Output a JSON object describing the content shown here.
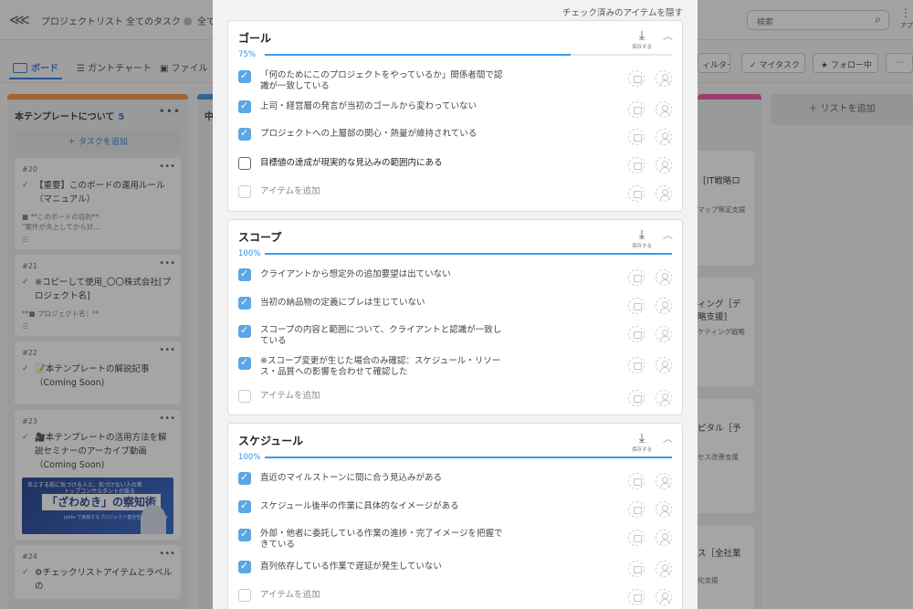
{
  "header": {
    "project_list": "プロジェクトリスト",
    "all_tasks": "全てのタスク",
    "all_prefix": "全て",
    "search_placeholder": "検索",
    "apps_label": "アプ"
  },
  "toolbar": {
    "tab_board": "ボード",
    "tab_gantt": "ガントチャート",
    "tab_file": "ファイル",
    "filter": "ィルター",
    "my_task": "マイタスク",
    "following": "フォロー中"
  },
  "board": {
    "column1": {
      "title": "本テンプレートについて",
      "count": "5",
      "add_task": "タスクを追加",
      "stripe_color": "#f5913e",
      "cards": [
        {
          "num": "#20",
          "title": "【重要】このボードの運用ルール（マニュアル）",
          "desc": "■ **このボードの目的**\n\"案件が炎上してから対..."
        },
        {
          "num": "#21",
          "title": "※コピーして使用_〇〇株式会社[プロジェクト名]",
          "desc": "**■ プロジェクト名：**"
        },
        {
          "num": "#22",
          "title": "📝本テンプレートの解説記事（Coming Soon)"
        },
        {
          "num": "#23",
          "title": "🎥本テンプレートの活用方法を解説セミナーのアーカイブ動画（Coming Soon)",
          "banner_top": "炎上する前に気づける人と、気づけない人の差",
          "banner_sub": "トップコンサルタントが語る",
          "banner_main": "「ざわめき」の察知術",
          "banner_foot": "Jooto で実装するプロジェクト健全性管理の仕組み"
        },
        {
          "num": "#24",
          "title": "⚙チェックリストアイテムとラベルの"
        }
      ]
    },
    "column2_prefix": "中",
    "right_cards": [
      {
        "title": "[IT戦略ロ",
        "sub": "マップ策定支援"
      },
      {
        "title": "ィング［デ",
        "title2": "略支援]",
        "sub": "ケティング戦略"
      },
      {
        "title": "ピタル［予",
        "sub": "セス改善支援"
      },
      {
        "title": "ス［全社業",
        "sub": "化支援"
      }
    ],
    "add_list": "リストを追加"
  },
  "checklist": {
    "hide_checked_label": "チェック済みのアイテムを隠す",
    "save_label": "保存する",
    "add_item_label": "アイテムを追加",
    "accent_color": "#3d9be9",
    "sections": [
      {
        "title": "ゴール",
        "progress_label": "75%",
        "progress": 0.75,
        "items": [
          {
            "text": "「何のためにこのプロジェクトをやっているか」関係者間で認識が一致している",
            "checked": true
          },
          {
            "text": "上司・経営層の発言が当初のゴールから変わっていない",
            "checked": true
          },
          {
            "text": "プロジェクトへの上層部の関心・熱量が維持されている",
            "checked": true
          },
          {
            "text": "目標値の達成が現実的な見込みの範囲内にある",
            "checked": false
          }
        ]
      },
      {
        "title": "スコープ",
        "progress_label": "100%",
        "progress": 1.0,
        "items": [
          {
            "text": "クライアントから想定外の追加要望は出ていない",
            "checked": true
          },
          {
            "text": "当初の納品物の定義にブレは生じていない",
            "checked": true
          },
          {
            "text": "スコープの内容と範囲について、クライアントと認識が一致している",
            "checked": true
          },
          {
            "text": "※スコープ変更が生じた場合のみ確認：スケジュール・リソース・品質への影響を合わせて確認した",
            "checked": true
          }
        ]
      },
      {
        "title": "スケジュール",
        "progress_label": "100%",
        "progress": 1.0,
        "items": [
          {
            "text": "直近のマイルストーンに間に合う見込みがある",
            "checked": true
          },
          {
            "text": "スケジュール後半の作業に具体的なイメージがある",
            "checked": true
          },
          {
            "text": "外部・他者に委託している作業の進捗・完了イメージを把握できている",
            "checked": true
          },
          {
            "text": "直列依存している作業で遅延が発生していない",
            "checked": true
          }
        ]
      }
    ]
  }
}
